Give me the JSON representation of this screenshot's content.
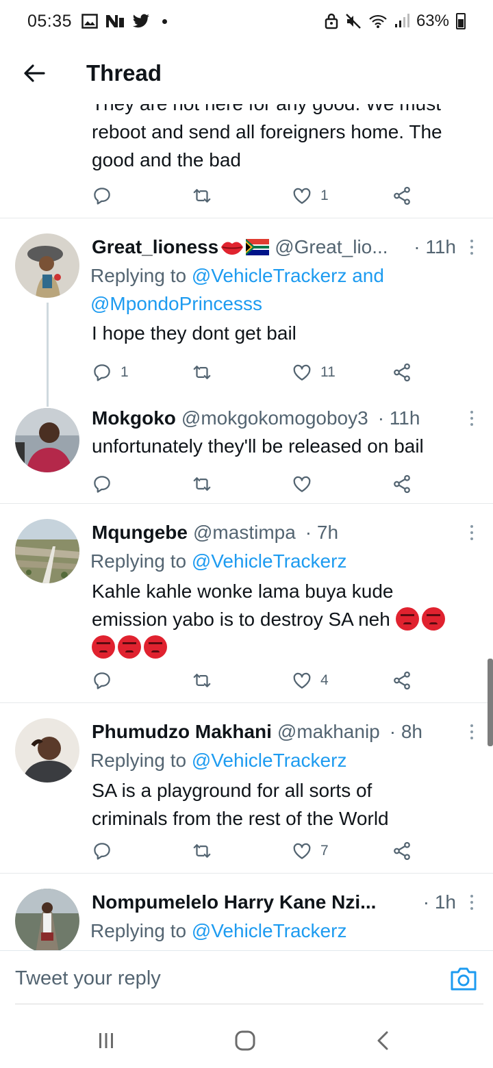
{
  "status_bar": {
    "time": "05:35",
    "battery": "63%"
  },
  "header": {
    "title": "Thread"
  },
  "partial_tweet": {
    "text_line1": "They are not here for any good. We must",
    "text_line2": "reboot and send all foreigners home. The",
    "text_line3": "good and the bad",
    "like_count": "1"
  },
  "tweets": [
    {
      "name": "Great_lioness",
      "handle": "@Great_lio...",
      "time": "· 11h",
      "replying_prefix": "Replying to ",
      "replying_to_1": "@VehicleTrackerz",
      "replying_and": " and",
      "replying_to_2": "@MpondoPrincesss",
      "text": "I hope they dont get bail",
      "reply_count": "1",
      "like_count": "11"
    },
    {
      "name": "Mokgoko",
      "handle": "@mokgokomogoboy3",
      "time": "· 11h",
      "text": "unfortunately they'll be released on bail"
    },
    {
      "name": "Mqungebe",
      "handle": "@mastimpa",
      "time": "· 7h",
      "replying_prefix": "Replying to ",
      "replying_to_1": "@VehicleTrackerz",
      "text_line1": "Kahle kahle wonke lama buya kude",
      "text_line2": "emission yabo is to destroy SA neh",
      "like_count": "4"
    },
    {
      "name": "Phumudzo Makhani",
      "handle": "@makhanip",
      "time": "· 8h",
      "replying_prefix": "Replying to ",
      "replying_to_1": "@VehicleTrackerz",
      "text_line1": "SA is a playground for all sorts of",
      "text_line2": "criminals from the rest of the World",
      "like_count": "7"
    },
    {
      "name": "Nompumelelo Harry Kane Nzi...",
      "time": "· 1h",
      "replying_prefix": "Replying to ",
      "replying_to_1": "@VehicleTrackerz"
    }
  ],
  "composer": {
    "placeholder": "Tweet your reply"
  },
  "colors": {
    "accent": "#1d9bf0",
    "muted": "#536471",
    "text": "#0f1419"
  }
}
